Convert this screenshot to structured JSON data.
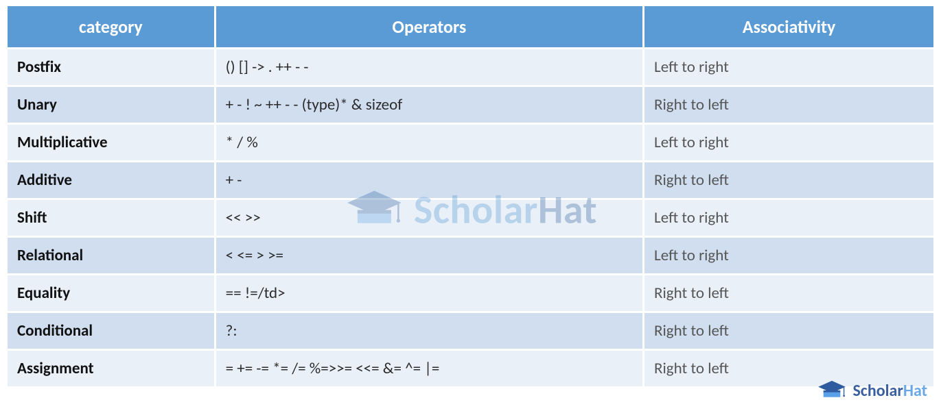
{
  "table": {
    "headers": {
      "col1": "category",
      "col2": "Operators",
      "col3": "Associativity"
    },
    "rows": [
      {
        "category": "Postfix",
        "operators": "() [] -> . ++ - -",
        "associativity": "Left to right",
        "shade": "light"
      },
      {
        "category": "Unary",
        "operators": "+ - ! ~ ++ - - (type)* & sizeof",
        "associativity": "Right to left",
        "shade": "mid"
      },
      {
        "category": "Multiplicative",
        "operators": "* / %",
        "associativity": "Left to right",
        "shade": "light"
      },
      {
        "category": "Additive",
        "operators": "+ -",
        "associativity": "Right to left",
        "shade": "mid"
      },
      {
        "category": "Shift",
        "operators": "<< >>",
        "associativity": "Left to right",
        "shade": "light"
      },
      {
        "category": "Relational",
        "operators": "< <= > >=",
        "associativity": "Left to right",
        "shade": "mid"
      },
      {
        "category": "Equality",
        "operators": "== !=/td>",
        "associativity": "Right to left",
        "shade": "light"
      },
      {
        "category": "Conditional",
        "operators": "?:",
        "associativity": "Right to left",
        "shade": "mid"
      },
      {
        "category": "Assignment",
        "operators": "= += -= *= /= %=>>= <<= &= ^= |=",
        "associativity": "Right to left",
        "shade": "light"
      }
    ]
  },
  "brand": {
    "name_main": "Scholar",
    "name_accent": "Hat"
  },
  "colors": {
    "header_bg": "#5b9bd5",
    "row_light": "#eaf0f8",
    "row_mid": "#d0def0",
    "brand_blue": "#3a5fa0",
    "brand_light": "#6aa8e8"
  }
}
